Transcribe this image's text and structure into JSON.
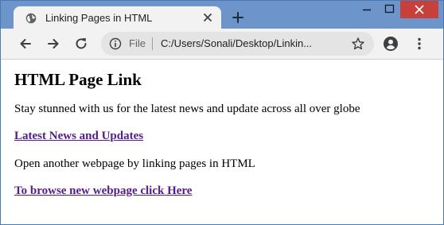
{
  "browser": {
    "tab_title": "Linking Pages in HTML",
    "address_scheme_label": "File",
    "address_url": "C:/Users/Sonali/Desktop/Linkin..."
  },
  "page": {
    "heading": "HTML Page Link",
    "paragraph_1": "Stay stunned with us for the latest news and update across all over globe",
    "link_1": "Latest News and Updates",
    "paragraph_2": "Open another webpage by linking pages in HTML",
    "link_2": "To browse new webpage click Here"
  },
  "colors": {
    "titlebar": "#6d95c9",
    "close_button": "#c7403a",
    "visited_link": "#551a8b"
  },
  "icons": [
    "globe-icon",
    "close-icon",
    "plus-icon",
    "minimize-icon",
    "maximize-icon",
    "window-close-icon",
    "back-arrow-icon",
    "forward-arrow-icon",
    "reload-icon",
    "info-icon",
    "star-icon",
    "account-icon",
    "menu-dots-icon"
  ]
}
